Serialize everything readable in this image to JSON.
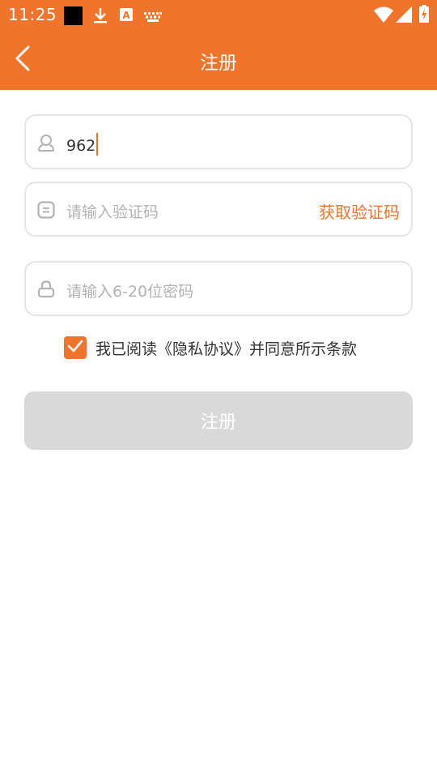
{
  "status_bar": {
    "time": "11:25",
    "icons": [
      "black-square-icon",
      "download-icon",
      "a-box-icon",
      "keyboard-icon",
      "wifi-icon",
      "signal-icon",
      "battery-charging-icon"
    ]
  },
  "app_bar": {
    "title": "注册",
    "back_icon": "chevron-left-icon"
  },
  "form": {
    "phone": {
      "value": "962",
      "icon": "user-icon"
    },
    "code": {
      "placeholder": "请输入验证码",
      "icon": "message-icon",
      "get_code_label": "获取验证码"
    },
    "password": {
      "placeholder": "请输入6-20位密码",
      "icon": "lock-icon"
    },
    "agreement": {
      "checked": true,
      "text": "我已阅读《隐私协议》并同意所示条款"
    },
    "submit_label": "注册"
  },
  "colors": {
    "primary": "#F0742B",
    "button_disabled": "#D9D9D9",
    "placeholder": "#B3B3B3",
    "border": "#E5E5E5"
  }
}
